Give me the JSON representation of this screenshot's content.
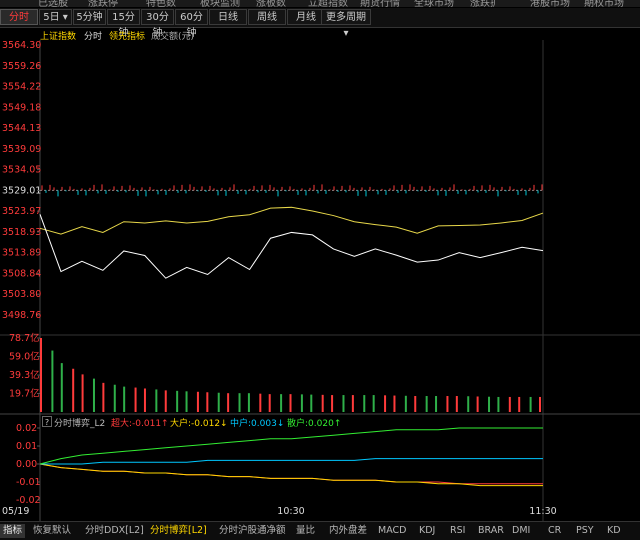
{
  "top_menu": [
    "已选股",
    "涨跌停",
    "特色数",
    "板块监测",
    "涨板数",
    "立超指数",
    "期货行情",
    "全球市场",
    "涨跌扩",
    "港股市场",
    "期权市场"
  ],
  "period_tabs": [
    {
      "label": "分时",
      "active": true
    },
    {
      "label": "5日",
      "dropdown": true
    },
    {
      "label": "5分钟"
    },
    {
      "label": "15分钟"
    },
    {
      "label": "30分钟"
    },
    {
      "label": "60分钟"
    },
    {
      "label": "日线"
    },
    {
      "label": "周线"
    },
    {
      "label": "月线"
    },
    {
      "label": "更多周期",
      "dropdown": true
    }
  ],
  "legend": {
    "index_name": "上证指数",
    "mode": "分时",
    "leading": "领先指标",
    "volume_label": "成交额(元)"
  },
  "price_axis": {
    "ticks": [
      "3564.30",
      "3559.26",
      "3554.22",
      "3549.18",
      "3544.13",
      "3539.09",
      "3534.05",
      "3529.01",
      "3523.97",
      "3518.93",
      "3513.89",
      "3508.84",
      "3503.80",
      "3498.76"
    ],
    "prev_close": "3529.01"
  },
  "volume_axis": {
    "ticks": [
      "78.7亿",
      "59.0亿",
      "39.3亿",
      "19.7亿"
    ]
  },
  "indicator": {
    "help": "?",
    "name": "分时博弈_L2",
    "super": "超大:-0.011",
    "large": "大户:-0.012",
    "medium": "中户:0.003",
    "retail": "散户:0.020",
    "arrows": {
      "super": "↑",
      "large": "↓",
      "medium": "↓",
      "retail": "↑"
    },
    "ticks": [
      "0.02",
      "0.01",
      "0.00",
      "-0.01",
      "-0.02"
    ]
  },
  "time_axis": {
    "start": "05/19",
    "mid": "10:30",
    "end": "11:30"
  },
  "bottom_tabs": [
    {
      "label": "指标",
      "first": true
    },
    {
      "label": "恢复默认"
    },
    {
      "label": "分时DDX[L2]"
    },
    {
      "label": "分时博弈[L2]",
      "active": true
    },
    {
      "label": "分时沪股通净额"
    },
    {
      "label": "量比"
    },
    {
      "label": "内外盘差"
    },
    {
      "label": "MACD"
    },
    {
      "label": "KDJ"
    },
    {
      "label": "RSI"
    },
    {
      "label": "BRAR"
    },
    {
      "label": "DMI"
    },
    {
      "label": "CR"
    },
    {
      "label": "PSY"
    },
    {
      "label": "KD"
    }
  ],
  "colors": {
    "up": "#ff3b3b",
    "down": "#00c8d8",
    "price_line": "#ffffff",
    "avg_line": "#e8d84a",
    "super": "#ff3b3b",
    "large": "#ffd800",
    "medium": "#00c8ff",
    "retail": "#33ee33",
    "axis": "#ff3b3b"
  },
  "chart_data": {
    "type": "line",
    "x": [
      "09:30",
      "09:35",
      "09:40",
      "09:45",
      "09:50",
      "09:55",
      "10:00",
      "10:05",
      "10:10",
      "10:15",
      "10:20",
      "10:25",
      "10:30",
      "10:35",
      "10:40",
      "10:45",
      "10:50",
      "10:55",
      "11:00",
      "11:05",
      "11:10",
      "11:15",
      "11:20",
      "11:25",
      "11:30"
    ],
    "series": [
      {
        "role": "price",
        "values": [
          3523.2,
          3509.3,
          3511.8,
          3509.6,
          3514.3,
          3513.2,
          3507.7,
          3510.3,
          3508.6,
          3512.7,
          3509.8,
          3517.4,
          3518.8,
          3518.2,
          3514.8,
          3513.0,
          3514.8,
          3513.3,
          3511.6,
          3512.1,
          3513.9,
          3512.7,
          3513.9,
          3515.2,
          3514.4
        ]
      },
      {
        "role": "average",
        "values": [
          3519.8,
          3518.4,
          3520.2,
          3518.8,
          3521.4,
          3521.1,
          3521.6,
          3521.1,
          3521.5,
          3522.6,
          3523.1,
          3524.7,
          3524.9,
          3524.0,
          3522.9,
          3521.4,
          3520.7,
          3520.1,
          3518.6,
          3520.4,
          3520.5,
          3520.6,
          3521.1,
          3521.7,
          3523.5
        ]
      },
      {
        "name": "超大",
        "values": [
          0.0,
          -0.002,
          -0.003,
          -0.004,
          -0.004,
          -0.005,
          -0.005,
          -0.006,
          -0.006,
          -0.007,
          -0.007,
          -0.008,
          -0.008,
          -0.008,
          -0.009,
          -0.009,
          -0.009,
          -0.01,
          -0.01,
          -0.01,
          -0.011,
          -0.011,
          -0.011,
          -0.011,
          -0.011
        ]
      },
      {
        "name": "大户",
        "values": [
          0.0,
          -0.002,
          -0.003,
          -0.004,
          -0.004,
          -0.005,
          -0.005,
          -0.006,
          -0.006,
          -0.007,
          -0.007,
          -0.008,
          -0.008,
          -0.008,
          -0.009,
          -0.009,
          -0.009,
          -0.01,
          -0.01,
          -0.011,
          -0.011,
          -0.012,
          -0.012,
          -0.012,
          -0.012
        ]
      },
      {
        "name": "中户",
        "values": [
          0.0,
          0.0,
          0.0,
          0.001,
          0.001,
          0.001,
          0.001,
          0.001,
          0.002,
          0.002,
          0.002,
          0.002,
          0.002,
          0.002,
          0.002,
          0.002,
          0.003,
          0.003,
          0.003,
          0.003,
          0.003,
          0.003,
          0.003,
          0.003,
          0.003
        ]
      },
      {
        "name": "散户",
        "values": [
          0.0,
          0.003,
          0.005,
          0.006,
          0.007,
          0.008,
          0.009,
          0.01,
          0.011,
          0.012,
          0.013,
          0.014,
          0.014,
          0.015,
          0.016,
          0.017,
          0.018,
          0.019,
          0.019,
          0.019,
          0.02,
          0.02,
          0.02,
          0.02,
          0.02
        ]
      }
    ],
    "volume": [
      78.7,
      52.0,
      40.0,
      31.0,
      27.0,
      25.0,
      23.0,
      22.0,
      21.0,
      20.0,
      20.0,
      19.0,
      19.0,
      18.5,
      18.0,
      18.0,
      18.0,
      17.5,
      17.0,
      17.0,
      17.0,
      16.5,
      16.0,
      16.0,
      16.0
    ],
    "ylim_price": [
      3498.76,
      3564.3
    ],
    "ylim_volume": [
      0,
      78.7
    ],
    "ylim_indicator": [
      -0.02,
      0.02
    ]
  }
}
